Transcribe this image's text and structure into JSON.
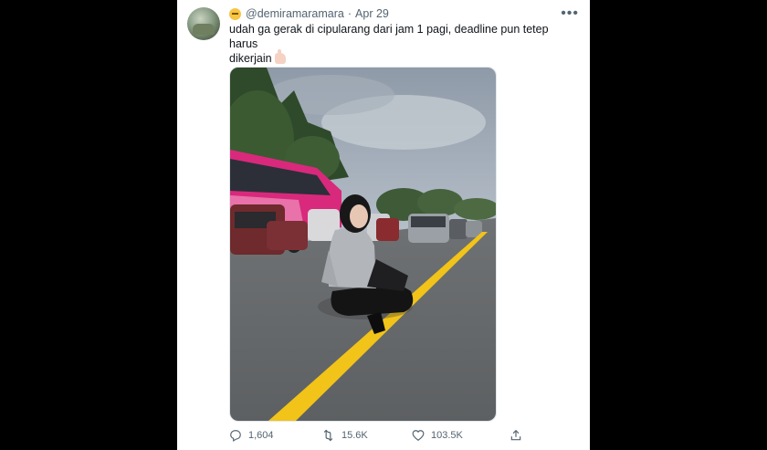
{
  "tweet": {
    "handle": "@demiramaramara",
    "separator": "·",
    "date": "Apr 29",
    "more_glyph": "•••",
    "text_line1": "udah ga gerak di cipularang dari jam 1 pagi, deadline pun tetep harus",
    "text_line2": "dikerjain"
  },
  "media": {
    "image_role": "photo"
  },
  "actions": {
    "replies": "1,604",
    "retweets": "15.6K",
    "likes": "103.5K"
  },
  "icons": {
    "reply": "reply-icon",
    "retweet": "retweet-icon",
    "like": "heart-icon",
    "share": "share-icon"
  },
  "colors": {
    "background": "#000000",
    "card": "#ffffff",
    "text": "#0f1419",
    "muted": "#536471",
    "road_line": "#f2c318"
  }
}
